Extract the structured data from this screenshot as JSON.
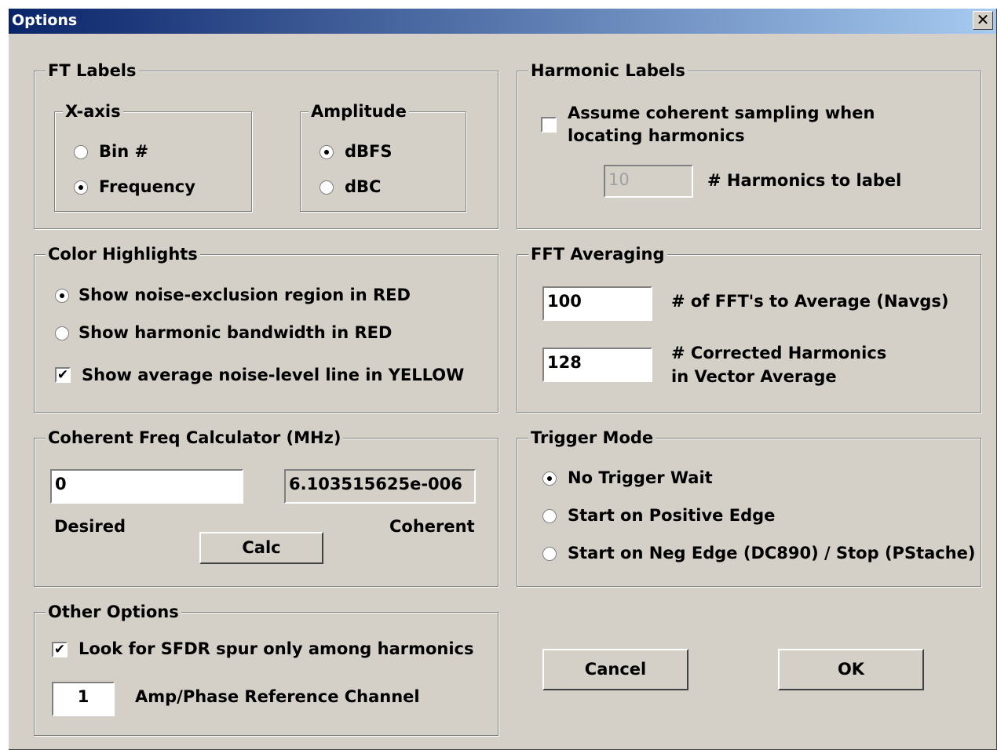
{
  "window": {
    "title": "Options",
    "close_glyph": "✕"
  },
  "ft_labels": {
    "legend": "FT Labels",
    "xaxis": {
      "legend": "X-axis",
      "options": [
        "Bin #",
        "Frequency"
      ],
      "selected": "Frequency"
    },
    "amplitude": {
      "legend": "Amplitude",
      "options": [
        "dBFS",
        "dBC"
      ],
      "selected": "dBFS"
    }
  },
  "harmonic_labels": {
    "legend": "Harmonic Labels",
    "coherent_line1": "Assume coherent sampling when",
    "coherent_line2": "locating harmonics",
    "coherent_checked": false,
    "count_value": "10",
    "count_label": "# Harmonics to label"
  },
  "color_highlights": {
    "legend": "Color Highlights",
    "noise_region": "Show noise-exclusion region in RED",
    "harmonic_bw": "Show harmonic bandwidth in RED",
    "selected": "noise_region",
    "avg_line": "Show average noise-level line in YELLOW",
    "avg_line_checked": true
  },
  "fft_averaging": {
    "legend": "FFT Averaging",
    "navgs_value": "100",
    "navgs_label": "# of FFT's to  Average (Navgs)",
    "corrected_value": "128",
    "corrected_line1": "# Corrected Harmonics",
    "corrected_line2": "in Vector Average"
  },
  "coherent_calc": {
    "legend": "Coherent Freq Calculator (MHz)",
    "desired_value": "0",
    "coherent_value": "6.103515625e-006",
    "desired_label": "Desired",
    "coherent_label": "Coherent",
    "calc_button": "Calc"
  },
  "trigger_mode": {
    "legend": "Trigger Mode",
    "options": [
      "No Trigger Wait",
      "Start on Positive Edge",
      "Start on Neg Edge (DC890) / Stop (PStache)"
    ],
    "selected": "No Trigger Wait"
  },
  "other_options": {
    "legend": "Other Options",
    "sfdr_label": "Look for SFDR spur only among harmonics",
    "sfdr_checked": true,
    "channel_value": "1",
    "channel_label": "Amp/Phase Reference Channel"
  },
  "buttons": {
    "cancel": "Cancel",
    "ok": "OK"
  },
  "colors": {
    "title_start": "#0a246a",
    "title_end": "#a6caf0",
    "face": "#d4d0c8"
  }
}
